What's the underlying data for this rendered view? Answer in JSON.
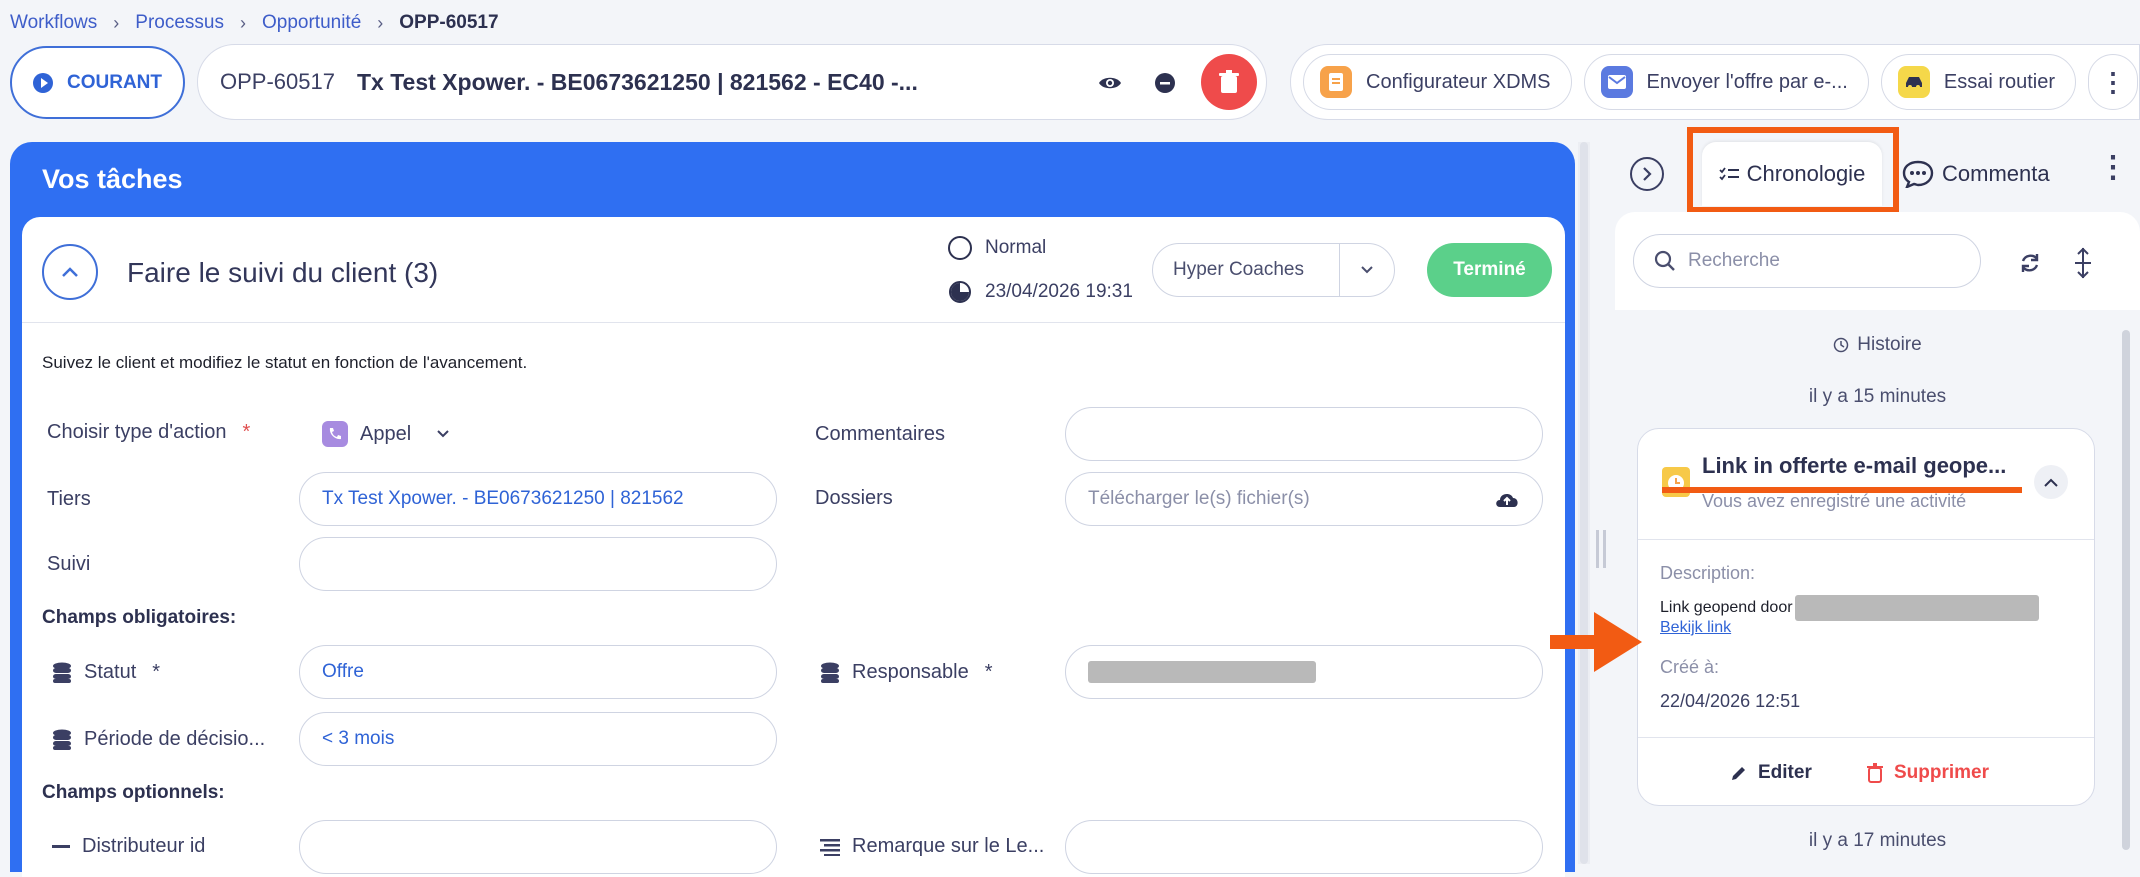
{
  "breadcrumb": [
    "Workflows",
    "Processus",
    "Opportunité",
    "OPP-60517"
  ],
  "header": {
    "status_label": "COURANT",
    "record_id": "OPP-60517",
    "record_name": "Tx Test Xpower. - BE0673621250 | 821562 - EC40 -...",
    "actions": [
      {
        "label": "Configurateur XDMS",
        "icon": "document-icon",
        "color": "#f7a24a"
      },
      {
        "label": "Envoyer l'offre par e-...",
        "icon": "mail-icon",
        "color": "#5b7ae0"
      },
      {
        "label": "Essai routier",
        "icon": "car-icon",
        "color": "#f5d84a"
      }
    ]
  },
  "tasks": {
    "panel_title": "Vos tâches",
    "title": "Faire le suivi du client (3)",
    "priority": "Normal",
    "due": "23/04/2026 19:31",
    "assignee": "Hyper Coaches",
    "done_label": "Terminé",
    "description": "Suivez le client et modifiez le statut en fonction de l'avancement.",
    "fields": {
      "action_type_label": "Choisir type d'action",
      "action_type_value": "Appel",
      "comments_label": "Commentaires",
      "tiers_label": "Tiers",
      "tiers_value": "Tx Test Xpower. - BE0673621250 | 821562",
      "dossiers_label": "Dossiers",
      "dossiers_placeholder": "Télécharger le(s) fichier(s)",
      "suivi_label": "Suivi",
      "mandatory_heading": "Champs obligatoires:",
      "statut_label": "Statut",
      "statut_value": "Offre",
      "responsable_label": "Responsable",
      "periode_label": "Période de décisio...",
      "periode_value": "< 3 mois",
      "optional_heading": "Champs optionnels:",
      "distributeur_label": "Distributeur id",
      "remarque_label": "Remarque sur le Le..."
    }
  },
  "sidebar": {
    "tabs": [
      "Chronologie",
      "Commenta"
    ],
    "search_placeholder": "Recherche",
    "history_label": "Histoire",
    "time_1": "il y a 15 minutes",
    "time_2": "il y a 17 minutes",
    "activity": {
      "title": "Link in offerte e-mail geope...",
      "subtitle": "Vous avez enregistré une activité",
      "description_label": "Description:",
      "description_text": "Link geopend door",
      "link_text": "Bekijk link",
      "created_label": "Créé à:",
      "created_value": "22/04/2026 12:51",
      "edit_label": "Editer",
      "delete_label": "Supprimer"
    }
  },
  "colors": {
    "primary": "#2f6ff2",
    "annotation": "#f25b13",
    "success": "#5bd08a",
    "danger": "#ef4b4b"
  }
}
